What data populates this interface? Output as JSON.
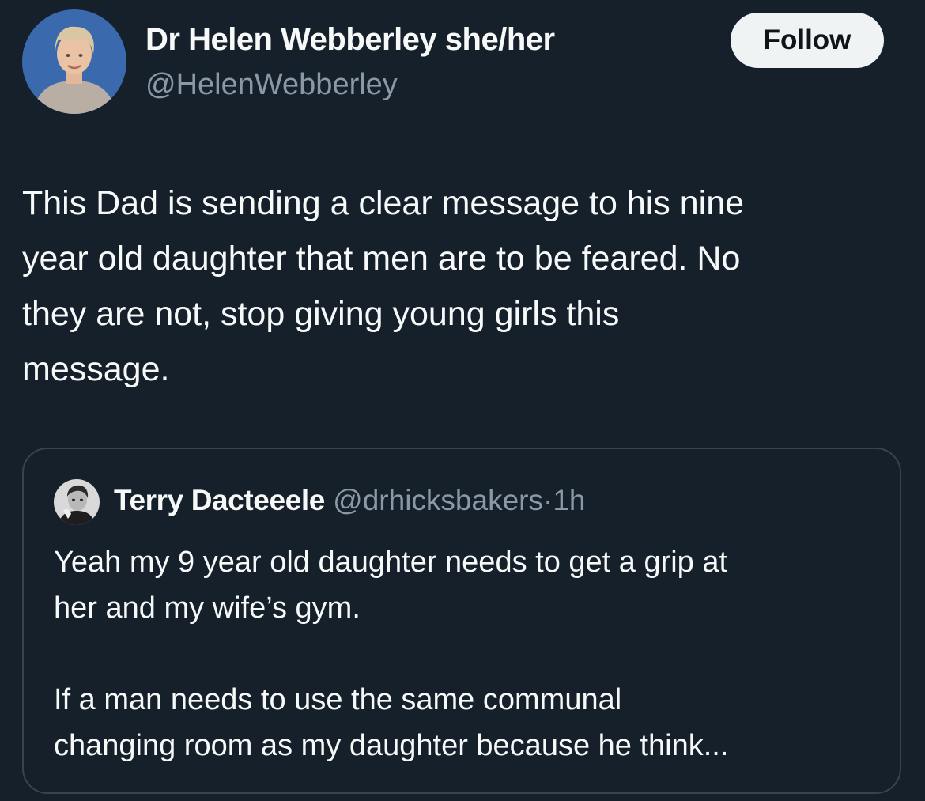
{
  "author": {
    "display_name": "Dr Helen Webberley she/her",
    "handle": "@HelenWebberley",
    "avatar_icon": "profile-photo"
  },
  "follow_button": {
    "label": "Follow"
  },
  "tweet": {
    "text": "This Dad is sending a clear message to his nine\nyear old daughter that men are to be feared. No\nthey are not, stop giving young girls this\nmessage."
  },
  "quoted_tweet": {
    "display_name": "Terry Dacteeele",
    "handle": "@drhicksbakers",
    "separator": "·",
    "time": "1h",
    "avatar_icon": "profile-photo",
    "text": "Yeah my 9 year old daughter needs to get a grip at\nher and my wife’s gym.\n\nIf a man needs to use the same communal\nchanging room as my daughter because he think..."
  },
  "colors": {
    "background": "#15202b",
    "text_primary": "#f7f9f9",
    "text_secondary": "#8b98a5",
    "border": "#38444d",
    "follow_bg": "#eff3f4"
  }
}
